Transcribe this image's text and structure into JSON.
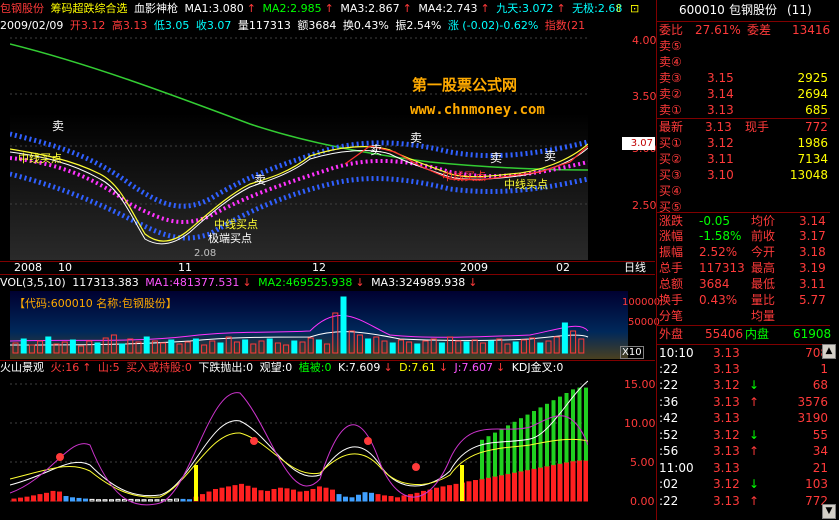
{
  "titlebar": {
    "stock": "包钢股份",
    "indicator_name": "筹码超跌综合选",
    "indicator2": "血影神枪",
    "ma1": "MA1:3.080",
    "ma2": "MA2:2.985",
    "ma3": "MA3:2.867",
    "ma4": "MA4:2.743",
    "jiutian": "九天:3.072",
    "wuji": "无极:2.68"
  },
  "inforow": {
    "date": "2009/02/09",
    "open": "开3.12",
    "high": "高3.13",
    "low": "低3.05",
    "close": "收3.07",
    "volume": "量117313",
    "amount": "额3684",
    "turnover": "换0.43%",
    "amplitude": "振2.54%",
    "change": "涨 (-0.02)-0.62%",
    "index": "指数(21"
  },
  "mainchart": {
    "watermark_title": "第一股票公式网",
    "watermark_url": "www.chnmoney.com",
    "yticks": [
      "4.00",
      "3.50",
      "3.00",
      "2.50"
    ],
    "current_price_tag": "3.07",
    "low_label": "2.08",
    "labels": {
      "sell1": "卖",
      "sell2": "卖",
      "sell3": "卖",
      "sell4": "卖",
      "sell5": "卖",
      "sell6": "卖",
      "midbuy1": "中线买点",
      "midbuy2": "中线买点",
      "midbuy3": "中线买点",
      "midbuy4": "中线买点",
      "extremebuy": "极端买点"
    }
  },
  "dateaxis": {
    "ticks": [
      "2008",
      "10",
      "11",
      "12",
      "2009",
      "02"
    ],
    "period": "日线"
  },
  "volrow": {
    "label": "VOL(3,5,10)",
    "value": "117313.383",
    "ma1": "MA1:481377.531",
    "ma2": "MA2:469525.938",
    "ma3": "MA3:324989.938"
  },
  "volchart": {
    "code_label": "【代码:600010 名称:包钢股份】",
    "yticks": [
      "100000",
      "50000",
      "X10"
    ]
  },
  "kdjrow": {
    "label": "火山景观",
    "huo": "火:16",
    "shan": "山:5",
    "buy": "买入或持股:0",
    "sell": "下跌抛出:0",
    "watch": "观望:0",
    "plant": "植被:0",
    "k": "K:7.609",
    "d": "D:7.61",
    "j": "J:7.607",
    "kdj": "KDJ金叉:0"
  },
  "kdjaxis": {
    "yticks": [
      "15.00",
      "10.00",
      "5.00",
      "0.00"
    ]
  },
  "panel": {
    "code": "600010",
    "name": "包钢股份",
    "pages": "(11)",
    "weibi_label": "委比",
    "weibi": "27.61%",
    "weicha_label": "委差",
    "weicha": "13416",
    "sell_rows": [
      {
        "label": "卖⑤",
        "price": "",
        "vol": ""
      },
      {
        "label": "卖④",
        "price": "",
        "vol": ""
      },
      {
        "label": "卖③",
        "price": "3.15",
        "vol": "2925"
      },
      {
        "label": "卖②",
        "price": "3.14",
        "vol": "2694"
      },
      {
        "label": "卖①",
        "price": "3.13",
        "vol": "685"
      }
    ],
    "latest_label": "最新",
    "latest": "3.13",
    "xianshou_label": "现手",
    "xianshou": "772",
    "buy_rows": [
      {
        "label": "买①",
        "price": "3.12",
        "vol": "1986"
      },
      {
        "label": "买②",
        "price": "3.11",
        "vol": "7134"
      },
      {
        "label": "买③",
        "price": "3.10",
        "vol": "13048"
      },
      {
        "label": "买④",
        "price": "",
        "vol": ""
      },
      {
        "label": "买⑤",
        "price": "",
        "vol": ""
      }
    ],
    "stats": [
      {
        "l1": "涨跌",
        "v1": "-0.05",
        "l2": "均价",
        "v2": "3.14"
      },
      {
        "l1": "涨幅",
        "v1": "-1.58%",
        "l2": "前收",
        "v2": "3.17"
      },
      {
        "l1": "振幅",
        "v1": "2.52%",
        "l2": "今开",
        "v2": "3.18"
      },
      {
        "l1": "总手",
        "v1": "117313",
        "l2": "最高",
        "v2": "3.19"
      },
      {
        "l1": "总额",
        "v1": "3684",
        "l2": "最低",
        "v2": "3.11"
      },
      {
        "l1": "换手",
        "v1": "0.43%",
        "l2": "量比",
        "v2": "5.77"
      },
      {
        "l1": "分笔",
        "v1": "",
        "l2": "均量",
        "v2": ""
      }
    ],
    "waipan_label": "外盘",
    "waipan": "55406",
    "neipan_label": "内盘",
    "neipan": "61908",
    "ticks": [
      {
        "t": "10:10",
        "p": "3.13",
        "a": "",
        "v": "708"
      },
      {
        "t": ":22",
        "p": "3.13",
        "a": "",
        "v": "1"
      },
      {
        "t": ":22",
        "p": "3.12",
        "a": "↓",
        "v": "68"
      },
      {
        "t": ":36",
        "p": "3.13",
        "a": "↑",
        "v": "3576"
      },
      {
        "t": ":42",
        "p": "3.13",
        "a": "",
        "v": "3190"
      },
      {
        "t": ":52",
        "p": "3.12",
        "a": "↓",
        "v": "55"
      },
      {
        "t": ":56",
        "p": "3.13",
        "a": "↑",
        "v": "34"
      },
      {
        "t": "11:00",
        "p": "3.13",
        "a": "",
        "v": "21"
      },
      {
        "t": ":02",
        "p": "3.12",
        "a": "↓",
        "v": "103"
      },
      {
        "t": ":22",
        "p": "3.13",
        "a": "↑",
        "v": "772"
      }
    ]
  },
  "colors": {
    "up": "#ff3a3a",
    "down": "#00ffff",
    "bg": "#000000",
    "accent": "#ffff00"
  }
}
